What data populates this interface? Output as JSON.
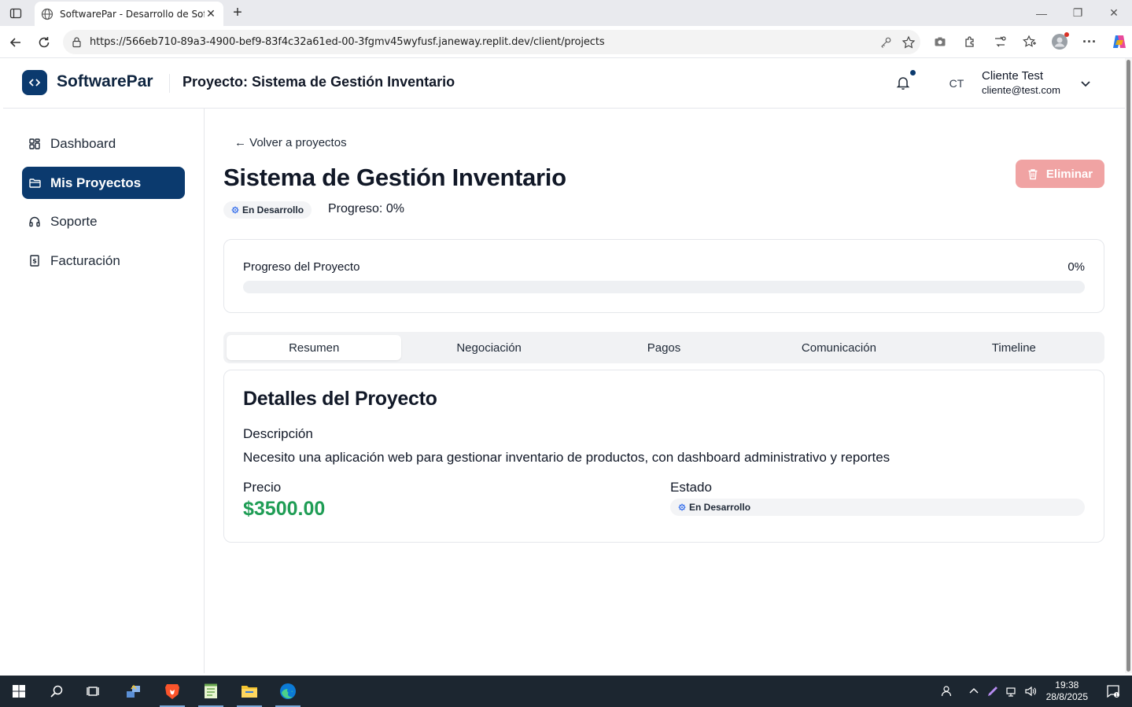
{
  "browser": {
    "tab_title": "SoftwarePar - Desarrollo de Software",
    "url": "https://566eb710-89a3-4900-bef9-83f4c32a61ed-00-3fgmv45wyfusf.janeway.replit.dev/client/projects"
  },
  "header": {
    "brand": "SoftwarePar",
    "project_title": "Proyecto: Sistema de Gestión Inventario",
    "avatar_initials": "CT",
    "user_name": "Cliente Test",
    "user_email": "cliente@test.com"
  },
  "sidebar": {
    "items": [
      {
        "label": "Dashboard",
        "icon": "grid-icon"
      },
      {
        "label": "Mis Proyectos",
        "icon": "folder-icon"
      },
      {
        "label": "Soporte",
        "icon": "headphones-icon"
      },
      {
        "label": "Facturación",
        "icon": "receipt-icon"
      }
    ]
  },
  "main": {
    "back_link": "← Volver a proyectos",
    "title": "Sistema de Gestión Inventario",
    "delete_label": "Eliminar",
    "status_badge": "En Desarrollo",
    "progress_text": "Progreso: 0%",
    "progress_card": {
      "label": "Progreso del Proyecto",
      "percent_text": "0%",
      "value": 0
    },
    "tabs": [
      "Resumen",
      "Negociación",
      "Pagos",
      "Comunicación",
      "Timeline"
    ],
    "details": {
      "title": "Detalles del Proyecto",
      "description_label": "Descripción",
      "description": "Necesito una aplicación web para gestionar inventario de productos, con dashboard administrativo y reportes",
      "price_label": "Precio",
      "price": "$3500.00",
      "status_label": "Estado",
      "status": "En Desarrollo"
    }
  },
  "taskbar": {
    "time": "19:38",
    "date": "28/8/2025"
  },
  "colors": {
    "brand": "#0b3a6e",
    "danger_light": "#f0a3a3",
    "price_green": "#1f9d55"
  }
}
